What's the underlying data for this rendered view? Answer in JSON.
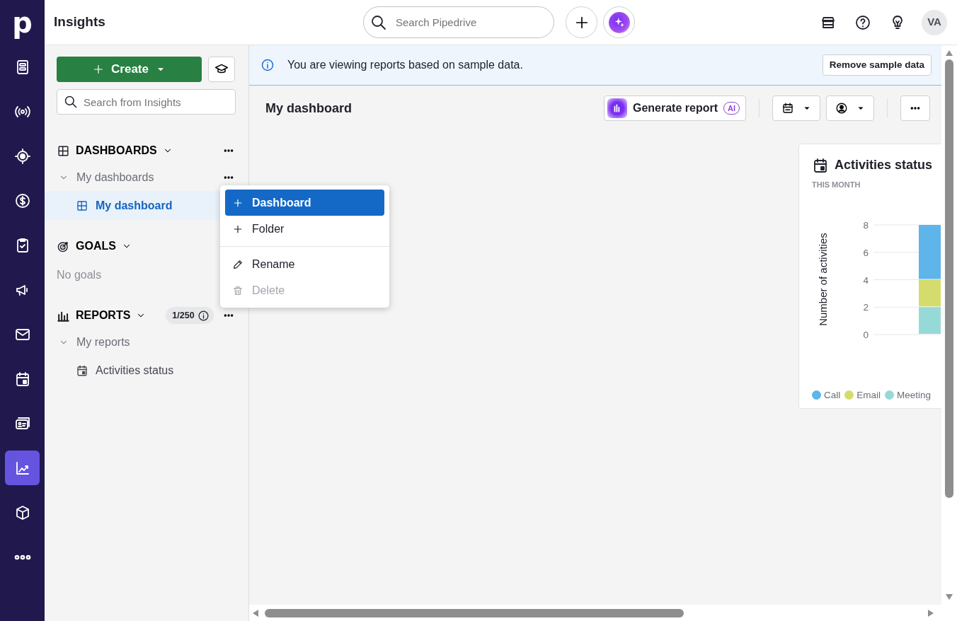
{
  "app_rail": {
    "logo": "p",
    "items": [
      {
        "kind": "leads",
        "selected": false
      },
      {
        "kind": "signal",
        "selected": false
      },
      {
        "kind": "target",
        "selected": false
      },
      {
        "kind": "deals",
        "selected": false
      },
      {
        "kind": "tasks",
        "selected": false
      },
      {
        "kind": "campaigns",
        "selected": false
      },
      {
        "kind": "mail",
        "selected": false
      },
      {
        "kind": "calendar",
        "selected": false
      },
      {
        "kind": "contacts",
        "selected": false
      },
      {
        "kind": "insights",
        "selected": true
      },
      {
        "kind": "products",
        "selected": false
      },
      {
        "kind": "more",
        "selected": false
      }
    ]
  },
  "top_bar": {
    "title": "Insights",
    "search_placeholder": "Search Pipedrive",
    "avatar": "VA"
  },
  "sidebar": {
    "create_button": "Create",
    "search_placeholder": "Search from Insights",
    "sections": [
      {
        "kind": "dashboards",
        "title": "DASHBOARDS",
        "children": [
          {
            "label": "My dashboards",
            "expanded": true,
            "children": [
              {
                "label": "My dashboard",
                "selected": true
              }
            ]
          }
        ]
      },
      {
        "kind": "goals",
        "title": "GOALS",
        "empty_text": "No goals"
      },
      {
        "kind": "reports",
        "title": "REPORTS",
        "count": "1/250",
        "children": [
          {
            "label": "My reports",
            "expanded": true,
            "children": [
              {
                "label": "Activities status",
                "selected": false
              }
            ]
          }
        ]
      }
    ]
  },
  "context_menu": {
    "groups": [
      [
        {
          "kind": "add",
          "label": "Dashboard",
          "selected": true,
          "disabled": false
        },
        {
          "kind": "add",
          "label": "Folder",
          "selected": false,
          "disabled": false
        }
      ],
      [
        {
          "kind": "rename",
          "label": "Rename",
          "selected": false,
          "disabled": false
        },
        {
          "kind": "delete",
          "label": "Delete",
          "selected": false,
          "disabled": true
        }
      ]
    ]
  },
  "banner": {
    "message": "You are viewing reports based on sample data.",
    "button": "Remove sample data"
  },
  "dashboard": {
    "title": "My dashboard",
    "generate_button": "Generate report",
    "ai_badge": "AI"
  },
  "report_card": {
    "subtitle": "THIS MONTH",
    "chart_data": {
      "type": "bar",
      "title": "Activities status",
      "ylabel": "Number of activities",
      "stacked": true,
      "grid": true,
      "ylim": [
        0,
        8
      ],
      "yticks": [
        0,
        2,
        4,
        6,
        8
      ],
      "series": [
        {
          "name": "Call",
          "color": "#5db5ea",
          "values": [
            4
          ]
        },
        {
          "name": "Email",
          "color": "#d3dc6c",
          "values": [
            2
          ]
        },
        {
          "name": "Meeting",
          "color": "#96dad8",
          "values": [
            2
          ]
        }
      ]
    }
  }
}
